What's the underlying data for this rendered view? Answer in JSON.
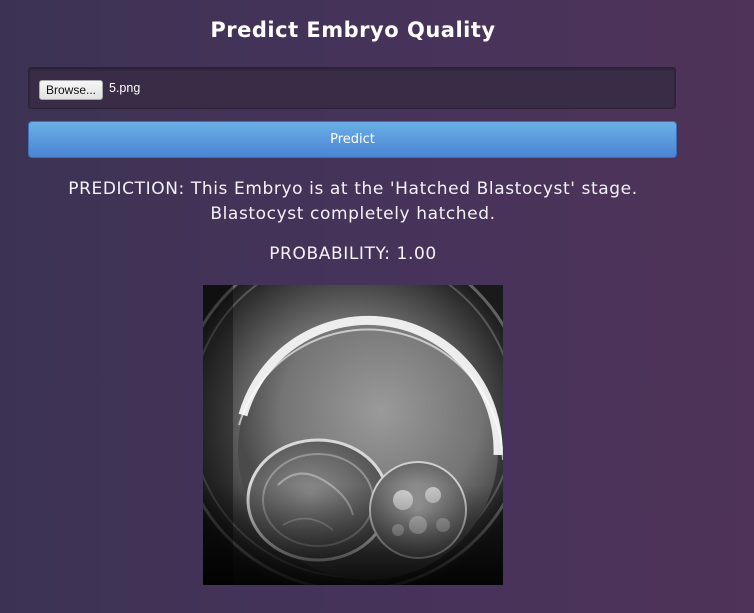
{
  "page": {
    "title": "Predict Embryo Quality"
  },
  "upload": {
    "browse_label": "Browse...",
    "file_name": "5.png"
  },
  "actions": {
    "predict_label": "Predict"
  },
  "result": {
    "prediction_line1": "PREDICTION: This Embryo is at the 'Hatched Blastocyst' stage.",
    "prediction_line2": "Blastocyst completely hatched.",
    "probability": "PROBABILITY: 1.00"
  }
}
